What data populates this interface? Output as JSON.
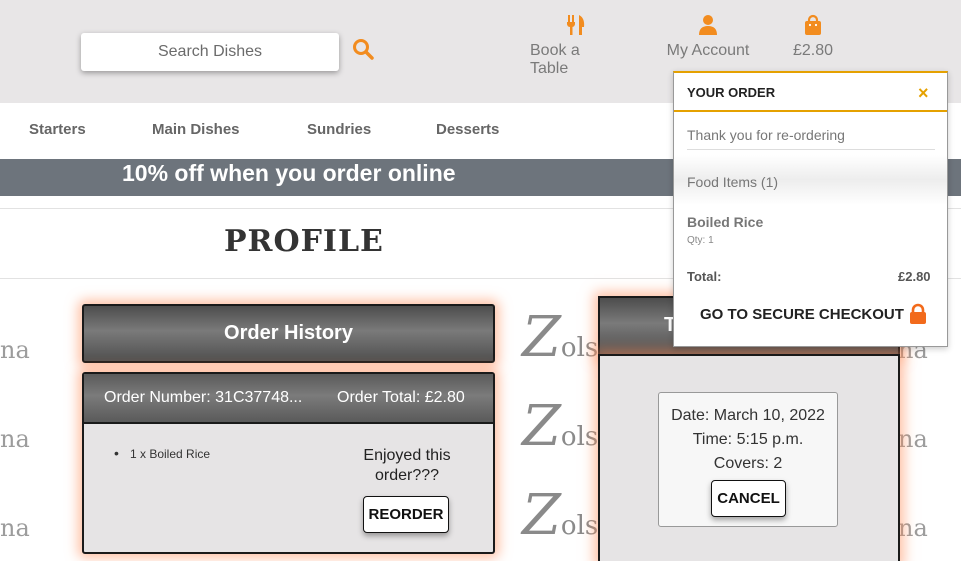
{
  "header": {
    "search_placeholder": "Search Dishes",
    "nav": [
      {
        "label": "Book a Table",
        "icon": "fork-knife-icon"
      },
      {
        "label": "My Account",
        "icon": "user-icon"
      },
      {
        "label": "£2.80",
        "icon": "shopping-bag-icon"
      }
    ]
  },
  "menu": [
    "Starters",
    "Main Dishes",
    "Sundries",
    "Desserts"
  ],
  "banner": "10% off when you order online",
  "page_title": "PROFILE",
  "watermark": {
    "side_text": "na",
    "logo_initial": "Z",
    "logo_rest": "olsh"
  },
  "order_history": {
    "title": "Order History",
    "order_number": "Order Number: 31C37748...",
    "order_total": "Order Total: £2.80",
    "items": [
      "1 x Boiled Rice"
    ],
    "enjoyed_text": "Enjoyed this order???",
    "reorder_label": "REORDER"
  },
  "booking": {
    "title_partial": "T",
    "date": "Date: March 10, 2022",
    "time": "Time: 5:15 p.m.",
    "covers": "Covers: 2",
    "cancel_label": "CANCEL"
  },
  "cart": {
    "title": "YOUR ORDER",
    "close": "×",
    "thanks": "Thank you for re-ordering",
    "food_items": "Food Items (1)",
    "item_name": "Boiled Rice",
    "item_qty": "Qty: 1",
    "total_label": "Total:",
    "total_value": "£2.80",
    "checkout_label": "GO TO SECURE CHECKOUT"
  },
  "colors": {
    "accent": "#f28c1f",
    "cart_border": "#e5a100",
    "banner": "#6d747c",
    "glow": "#ff8c5a",
    "lock": "#f26a1b"
  }
}
